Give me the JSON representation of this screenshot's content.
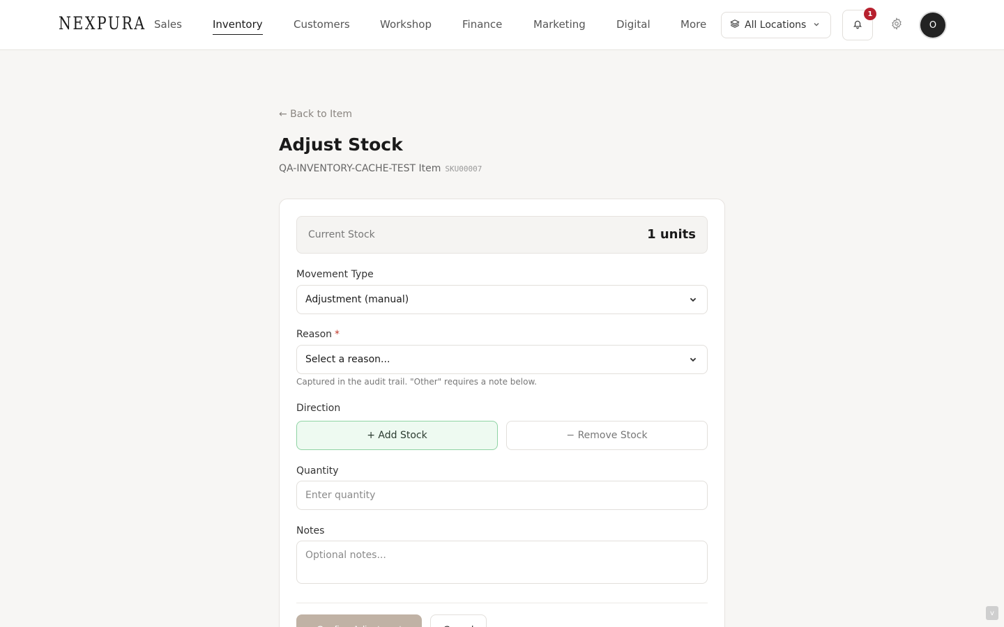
{
  "header": {
    "logo": "NEXPURA",
    "nav": [
      {
        "label": "Sales"
      },
      {
        "label": "Inventory",
        "active": true
      },
      {
        "label": "Customers"
      },
      {
        "label": "Workshop"
      },
      {
        "label": "Finance"
      },
      {
        "label": "Marketing"
      },
      {
        "label": "Digital"
      },
      {
        "label": "More"
      }
    ],
    "location_label": "All Locations",
    "notifications_count": "1",
    "avatar_initial": "O"
  },
  "page": {
    "back_link": "← Back to Item",
    "title": "Adjust Stock",
    "item_name": "QA-INVENTORY-CACHE-TEST Item",
    "sku": "SKU00007"
  },
  "form": {
    "current_stock_label": "Current Stock",
    "current_stock_value": "1 units",
    "movement_type_label": "Movement Type",
    "movement_type_value": "Adjustment (manual)",
    "reason_label": "Reason",
    "reason_required_mark": "*",
    "reason_value": "Select a reason...",
    "reason_hint": "Captured in the audit trail. \"Other\" requires a note below.",
    "direction_label": "Direction",
    "add_stock_label": "+ Add Stock",
    "remove_stock_label": "− Remove Stock",
    "quantity_label": "Quantity",
    "quantity_placeholder": "Enter quantity",
    "notes_label": "Notes",
    "notes_placeholder": "Optional notes...",
    "confirm_label": "Confirm Adjustment",
    "cancel_label": "Cancel"
  },
  "colors": {
    "accent_add_bg": "#eefaf1",
    "accent_add_border": "#8fd3a3",
    "confirm_bg": "#c0b2a5",
    "badge": "#b7202e"
  },
  "icons": {
    "location": "layers-icon",
    "notifications": "bell-icon",
    "settings": "gear-icon",
    "dropdown": "chevron-down-icon"
  },
  "misc": {
    "corner_button_label": "v"
  }
}
